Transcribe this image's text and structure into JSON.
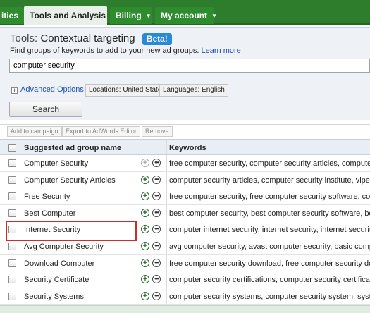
{
  "nav": {
    "tabs": [
      {
        "label": "ities",
        "active": false
      },
      {
        "label": "Tools and Analysis",
        "active": true
      },
      {
        "label": "Billing",
        "active": false
      },
      {
        "label": "My account",
        "active": false
      }
    ]
  },
  "tools": {
    "prefix": "Tools:",
    "title": "Contextual targeting",
    "badge": "Beta!",
    "description": "Find groups of keywords to add to your new ad groups.",
    "learn_more": "Learn more",
    "search_value": "computer security",
    "advanced_options": "Advanced Options",
    "locations": "Locations: United States",
    "languages": "Languages: English",
    "search_button": "Search"
  },
  "toolbar": {
    "add_to_campaign": "Add to campaign",
    "export": "Export to AdWords Editor",
    "remove": "Remove"
  },
  "table": {
    "headers": [
      "Suggested ad group name",
      "Keywords"
    ],
    "rows": [
      {
        "name": "Computer Security",
        "keywords": "free computer security, computer security articles, computer security",
        "add_enabled": false
      },
      {
        "name": "Computer Security Articles",
        "keywords": "computer security articles, computer security institute, viper computer",
        "add_enabled": true
      },
      {
        "name": "Free Security",
        "keywords": "free computer security, free computer security software, computer",
        "add_enabled": true
      },
      {
        "name": "Best Computer",
        "keywords": "best computer security, best computer security software, best com",
        "add_enabled": true
      },
      {
        "name": "Internet Security",
        "keywords": "computer internet security, internet security, internet security softwa",
        "add_enabled": true
      },
      {
        "name": "Avg Computer Security",
        "keywords": "avg computer security, avast computer security, basic computer se",
        "add_enabled": true
      },
      {
        "name": "Download Computer",
        "keywords": "free computer security download, free computer security download",
        "add_enabled": true
      },
      {
        "name": "Security Certificate",
        "keywords": "computer security certifications, computer security certification, ce",
        "add_enabled": true
      },
      {
        "name": "Security Systems",
        "keywords": "computer security systems, computer security system, system secu",
        "add_enabled": true
      }
    ]
  },
  "colors": {
    "nav_green": "#2d7d2d",
    "panel_bg": "#eef2f7",
    "link": "#1a4fb0",
    "beta_badge": "#2a8ad6",
    "highlight": "#d02a2a"
  }
}
